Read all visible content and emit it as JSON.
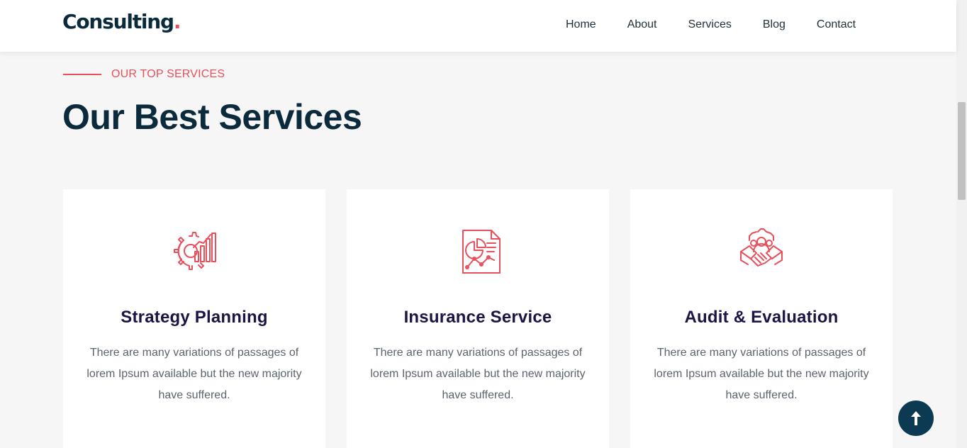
{
  "logo": {
    "text": "Consulting",
    "dot": "."
  },
  "nav": [
    {
      "label": "Home"
    },
    {
      "label": "About"
    },
    {
      "label": "Services"
    },
    {
      "label": "Blog"
    },
    {
      "label": "Contact"
    }
  ],
  "section": {
    "eyebrow": "OUR TOP SERVICES",
    "title": "Our Best Services"
  },
  "cards": [
    {
      "icon": "strategy-gear-chart-icon",
      "title": "Strategy Planning",
      "text": "There are many variations of passages of lorem Ipsum available but the new majority have suffered."
    },
    {
      "icon": "insurance-report-icon",
      "title": "Insurance Service",
      "text": "There are many variations of passages of lorem Ipsum available but the new majority have suffered."
    },
    {
      "icon": "audit-handshake-icon",
      "title": "Audit & Evaluation",
      "text": "There are many variations of passages of lorem Ipsum available but the new majority have suffered."
    }
  ],
  "colors": {
    "accent": "#e8505b",
    "navy": "#0b2b3c",
    "card_title": "#1a1545",
    "background": "#f6f6f6",
    "back_to_top": "#0b3a52"
  },
  "back_to_top": {
    "icon": "arrow-up-icon"
  }
}
